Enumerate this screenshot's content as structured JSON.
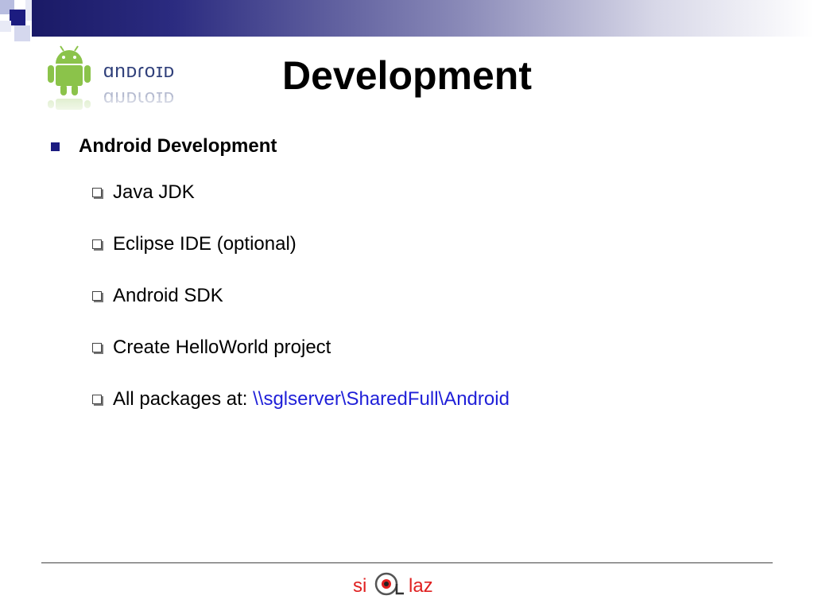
{
  "slide": {
    "title": "Development",
    "logo_text": "android",
    "main_bullet": "Android Development",
    "sub_bullets": [
      {
        "text": "Java JDK"
      },
      {
        "text": "Eclipse IDE (optional)"
      },
      {
        "text": "Android SDK"
      },
      {
        "text": "Create HelloWorld project"
      },
      {
        "text": "All packages at: ",
        "link": "\\\\sglserver\\SharedFull\\Android"
      }
    ],
    "footer_logo_left": "si",
    "footer_logo_right": "laz"
  },
  "colors": {
    "accent": "#1c1c80",
    "link": "#1f1fd8",
    "android_green": "#8bc34a",
    "logo_red": "#e02020"
  }
}
